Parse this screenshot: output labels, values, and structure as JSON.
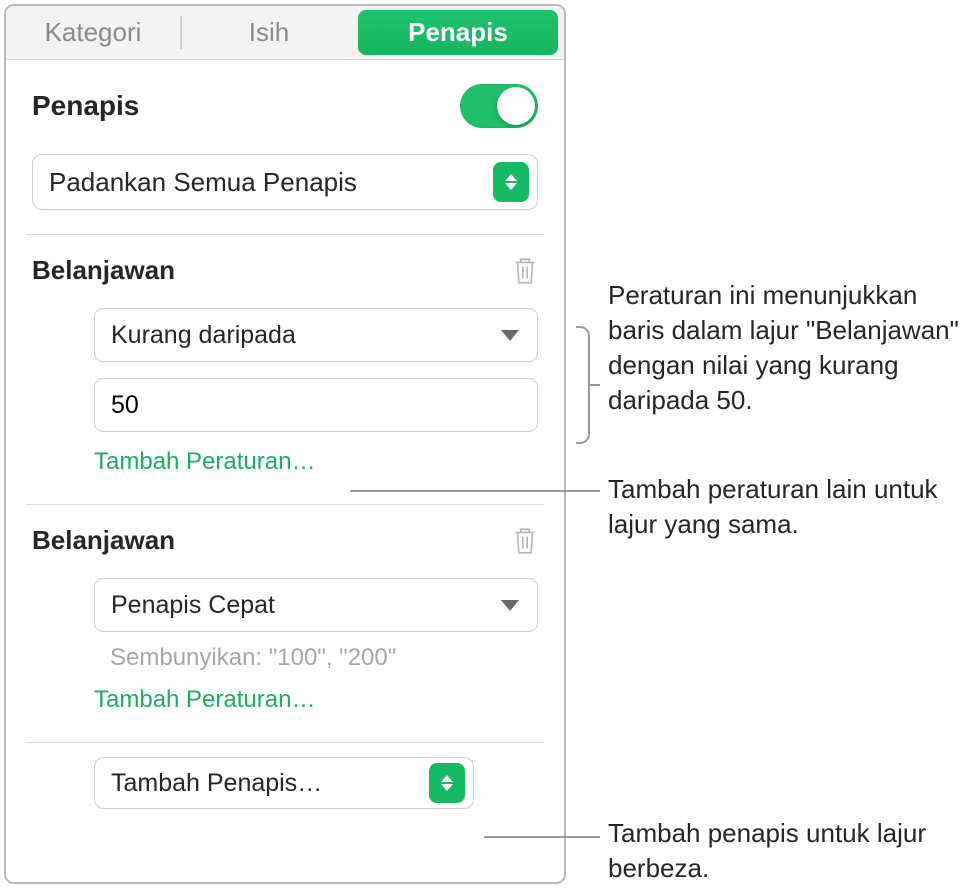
{
  "tabs": {
    "kategori": "Kategori",
    "isih": "Isih",
    "penapis": "Penapis"
  },
  "header": {
    "title": "Penapis",
    "toggle_on": true
  },
  "match": {
    "label": "Padankan Semua Penapis"
  },
  "groups": [
    {
      "title": "Belanjawan",
      "rule_type": "Kurang daripada",
      "value": "50",
      "add_rule": "Tambah Peraturan…"
    },
    {
      "title": "Belanjawan",
      "rule_type": "Penapis Cepat",
      "hide_text": "Sembunyikan: \"100\", \"200\"",
      "add_rule": "Tambah Peraturan…"
    }
  ],
  "add_filter": {
    "label": "Tambah Penapis…"
  },
  "callouts": {
    "c1": "Peraturan ini menunjukkan baris dalam lajur \"Belanjawan\" dengan nilai yang kurang daripada 50.",
    "c2": "Tambah peraturan lain untuk lajur yang sama.",
    "c3": "Tambah penapis untuk lajur berbeza."
  }
}
